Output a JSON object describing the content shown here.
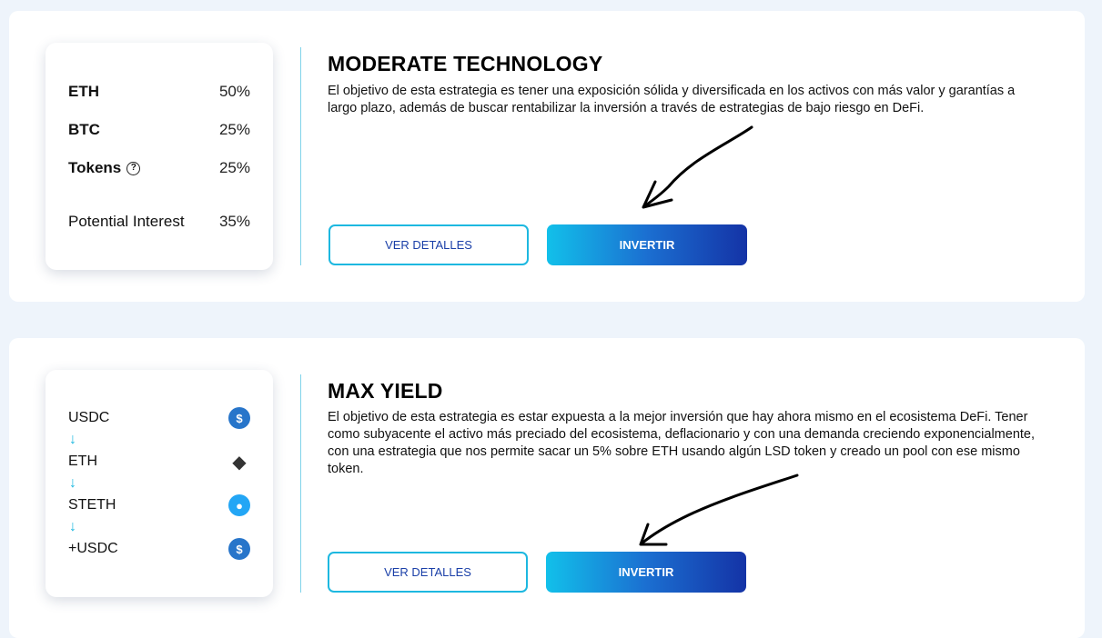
{
  "strategies": [
    {
      "title": "MODERATE TECHNOLOGY",
      "description": "El objetivo de esta estrategia es tener una exposición sólida y diversificada en los activos con más valor y garantías a largo plazo, además de buscar rentabilizar la inversión a través de estrategias de bajo riesgo en DeFi.",
      "allocation": [
        {
          "label": "ETH",
          "value": "50%"
        },
        {
          "label": "BTC",
          "value": "25%"
        },
        {
          "label": "Tokens",
          "value": "25%",
          "icon": "help-circle-icon"
        },
        {
          "label": "Potential Interest",
          "value": "35%"
        }
      ],
      "details_label": "VER DETALLES",
      "invest_label": "INVERTIR"
    },
    {
      "title": "MAX YIELD",
      "description": "El objetivo de esta estrategia es estar expuesta a la mejor inversión que hay ahora mismo en el ecosistema DeFi. Tener como subyacente el activo más preciado del ecosistema, deflacionario y con una demanda creciendo exponencialmente, con una estrategia que nos permite sacar un 5% sobre ETH usando algún LSD token y creado un pool con ese mismo token.",
      "flow": [
        {
          "label": "USDC",
          "icon": "usdc-icon"
        },
        {
          "label": "ETH",
          "icon": "eth-icon"
        },
        {
          "label": "STETH",
          "icon": "steth-icon"
        },
        {
          "label": "+USDC",
          "icon": "usdc-icon"
        }
      ],
      "flow_arrow": "↓",
      "details_label": "VER DETALLES",
      "invest_label": "INVERTIR"
    }
  ],
  "colors": {
    "accent": "#1db8e0",
    "button_gradient_start": "#12c0ea",
    "button_gradient_end": "#1433a6",
    "background": "#eef4fb"
  }
}
